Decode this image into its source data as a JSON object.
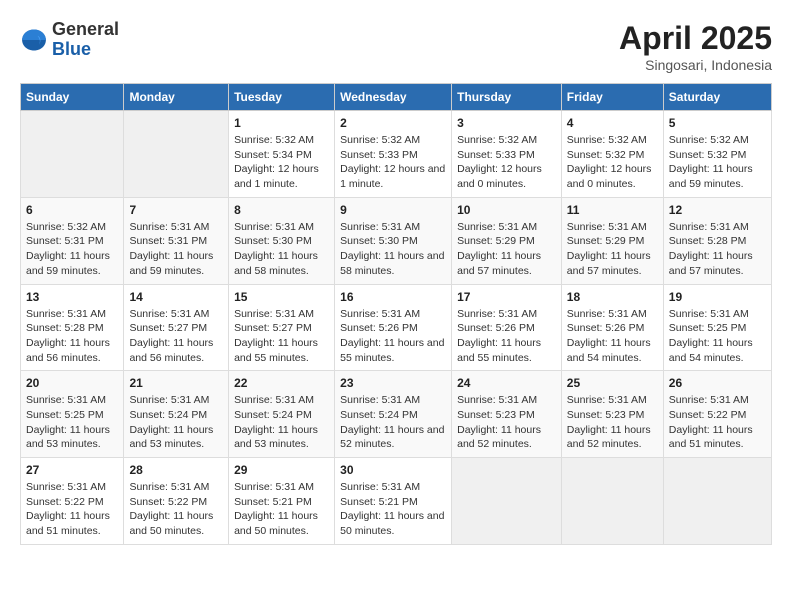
{
  "logo": {
    "general": "General",
    "blue": "Blue"
  },
  "header": {
    "month_year": "April 2025",
    "location": "Singosari, Indonesia"
  },
  "weekdays": [
    "Sunday",
    "Monday",
    "Tuesday",
    "Wednesday",
    "Thursday",
    "Friday",
    "Saturday"
  ],
  "weeks": [
    [
      {
        "day": "",
        "info": ""
      },
      {
        "day": "",
        "info": ""
      },
      {
        "day": "1",
        "info": "Sunrise: 5:32 AM\nSunset: 5:34 PM\nDaylight: 12 hours and 1 minute."
      },
      {
        "day": "2",
        "info": "Sunrise: 5:32 AM\nSunset: 5:33 PM\nDaylight: 12 hours and 1 minute."
      },
      {
        "day": "3",
        "info": "Sunrise: 5:32 AM\nSunset: 5:33 PM\nDaylight: 12 hours and 0 minutes."
      },
      {
        "day": "4",
        "info": "Sunrise: 5:32 AM\nSunset: 5:32 PM\nDaylight: 12 hours and 0 minutes."
      },
      {
        "day": "5",
        "info": "Sunrise: 5:32 AM\nSunset: 5:32 PM\nDaylight: 11 hours and 59 minutes."
      }
    ],
    [
      {
        "day": "6",
        "info": "Sunrise: 5:32 AM\nSunset: 5:31 PM\nDaylight: 11 hours and 59 minutes."
      },
      {
        "day": "7",
        "info": "Sunrise: 5:31 AM\nSunset: 5:31 PM\nDaylight: 11 hours and 59 minutes."
      },
      {
        "day": "8",
        "info": "Sunrise: 5:31 AM\nSunset: 5:30 PM\nDaylight: 11 hours and 58 minutes."
      },
      {
        "day": "9",
        "info": "Sunrise: 5:31 AM\nSunset: 5:30 PM\nDaylight: 11 hours and 58 minutes."
      },
      {
        "day": "10",
        "info": "Sunrise: 5:31 AM\nSunset: 5:29 PM\nDaylight: 11 hours and 57 minutes."
      },
      {
        "day": "11",
        "info": "Sunrise: 5:31 AM\nSunset: 5:29 PM\nDaylight: 11 hours and 57 minutes."
      },
      {
        "day": "12",
        "info": "Sunrise: 5:31 AM\nSunset: 5:28 PM\nDaylight: 11 hours and 57 minutes."
      }
    ],
    [
      {
        "day": "13",
        "info": "Sunrise: 5:31 AM\nSunset: 5:28 PM\nDaylight: 11 hours and 56 minutes."
      },
      {
        "day": "14",
        "info": "Sunrise: 5:31 AM\nSunset: 5:27 PM\nDaylight: 11 hours and 56 minutes."
      },
      {
        "day": "15",
        "info": "Sunrise: 5:31 AM\nSunset: 5:27 PM\nDaylight: 11 hours and 55 minutes."
      },
      {
        "day": "16",
        "info": "Sunrise: 5:31 AM\nSunset: 5:26 PM\nDaylight: 11 hours and 55 minutes."
      },
      {
        "day": "17",
        "info": "Sunrise: 5:31 AM\nSunset: 5:26 PM\nDaylight: 11 hours and 55 minutes."
      },
      {
        "day": "18",
        "info": "Sunrise: 5:31 AM\nSunset: 5:26 PM\nDaylight: 11 hours and 54 minutes."
      },
      {
        "day": "19",
        "info": "Sunrise: 5:31 AM\nSunset: 5:25 PM\nDaylight: 11 hours and 54 minutes."
      }
    ],
    [
      {
        "day": "20",
        "info": "Sunrise: 5:31 AM\nSunset: 5:25 PM\nDaylight: 11 hours and 53 minutes."
      },
      {
        "day": "21",
        "info": "Sunrise: 5:31 AM\nSunset: 5:24 PM\nDaylight: 11 hours and 53 minutes."
      },
      {
        "day": "22",
        "info": "Sunrise: 5:31 AM\nSunset: 5:24 PM\nDaylight: 11 hours and 53 minutes."
      },
      {
        "day": "23",
        "info": "Sunrise: 5:31 AM\nSunset: 5:24 PM\nDaylight: 11 hours and 52 minutes."
      },
      {
        "day": "24",
        "info": "Sunrise: 5:31 AM\nSunset: 5:23 PM\nDaylight: 11 hours and 52 minutes."
      },
      {
        "day": "25",
        "info": "Sunrise: 5:31 AM\nSunset: 5:23 PM\nDaylight: 11 hours and 52 minutes."
      },
      {
        "day": "26",
        "info": "Sunrise: 5:31 AM\nSunset: 5:22 PM\nDaylight: 11 hours and 51 minutes."
      }
    ],
    [
      {
        "day": "27",
        "info": "Sunrise: 5:31 AM\nSunset: 5:22 PM\nDaylight: 11 hours and 51 minutes."
      },
      {
        "day": "28",
        "info": "Sunrise: 5:31 AM\nSunset: 5:22 PM\nDaylight: 11 hours and 50 minutes."
      },
      {
        "day": "29",
        "info": "Sunrise: 5:31 AM\nSunset: 5:21 PM\nDaylight: 11 hours and 50 minutes."
      },
      {
        "day": "30",
        "info": "Sunrise: 5:31 AM\nSunset: 5:21 PM\nDaylight: 11 hours and 50 minutes."
      },
      {
        "day": "",
        "info": ""
      },
      {
        "day": "",
        "info": ""
      },
      {
        "day": "",
        "info": ""
      }
    ]
  ]
}
